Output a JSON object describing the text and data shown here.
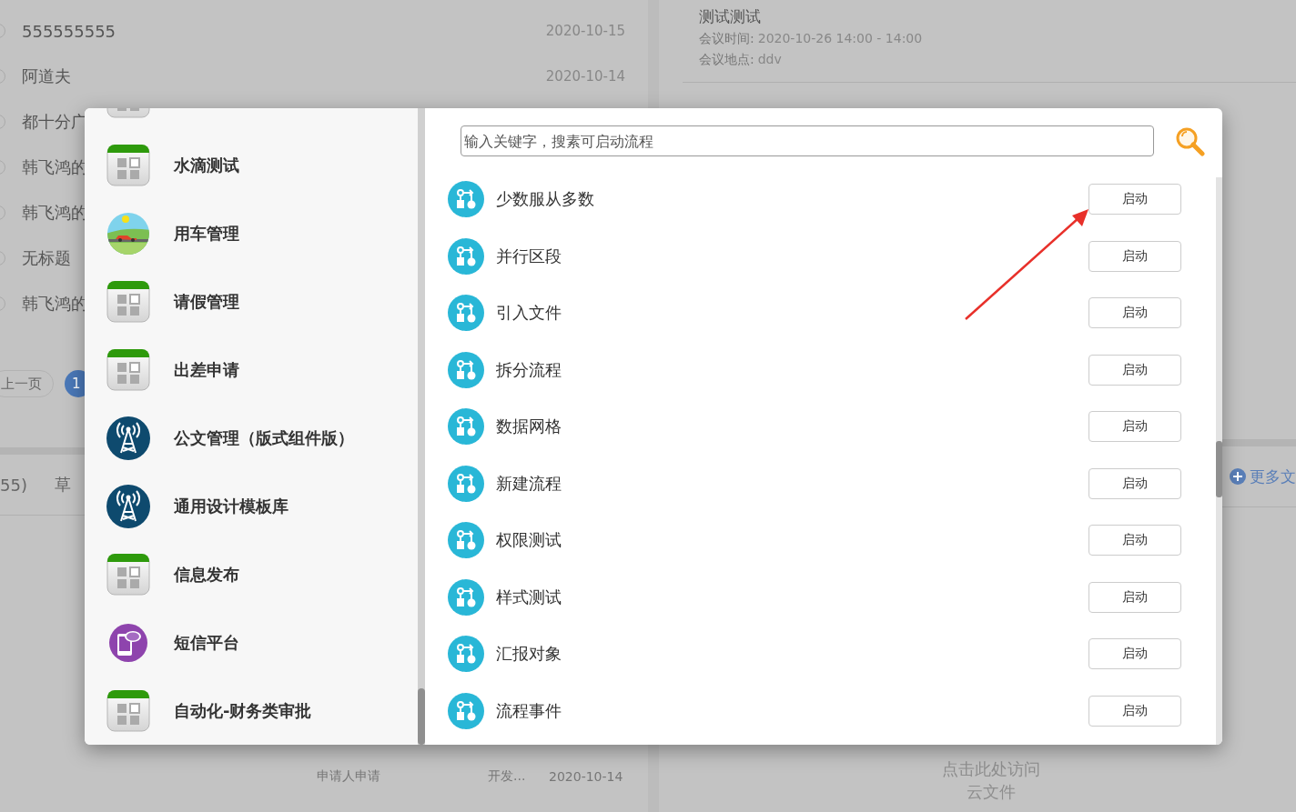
{
  "background": {
    "documents": [
      {
        "title": "555555555",
        "date": "2020-10-15"
      },
      {
        "title": "阿道夫",
        "date": "2020-10-14"
      },
      {
        "title": "都十分广"
      },
      {
        "title": "韩飞鸿的"
      },
      {
        "title": "韩飞鸿的"
      },
      {
        "title": "无标题"
      },
      {
        "title": "韩飞鸿的"
      }
    ],
    "pagination": {
      "prev": "上一页",
      "pages": [
        {
          "label": "1",
          "selected": true
        }
      ]
    },
    "tabs": [
      {
        "label": "55)"
      },
      {
        "label": "草"
      }
    ],
    "bottom_row": {
      "column_1": "申请人申请",
      "column_2": "开发...",
      "column_3": "2020-10-14"
    },
    "meeting": {
      "title": "测试测试",
      "time_label": "会议时间:",
      "time": "2020-10-26 14:00 - 14:00",
      "place_label": "会议地点:",
      "place": "ddv"
    },
    "more_files": "更多文",
    "cloud_link": [
      "点击此处访问",
      "云文件"
    ]
  },
  "dialog": {
    "apps": [
      {
        "kind": "grid"
      },
      {
        "name": "水滴测试",
        "kind": "grid"
      },
      {
        "name": "用车管理",
        "kind": "car"
      },
      {
        "name": "请假管理",
        "kind": "grid"
      },
      {
        "name": "出差申请",
        "kind": "grid"
      },
      {
        "name": "公文管理（版式组件版）",
        "kind": "antenna"
      },
      {
        "name": "通用设计模板库",
        "kind": "antenna"
      },
      {
        "name": "信息发布",
        "kind": "grid"
      },
      {
        "name": "短信平台",
        "kind": "sms"
      },
      {
        "name": "自动化-财务类审批",
        "kind": "grid"
      }
    ],
    "search": {
      "placeholder": "输入关键字，搜素可启动流程"
    },
    "processes": [
      {
        "name": "少数服从多数",
        "button": "启动"
      },
      {
        "name": "并行区段",
        "button": "启动"
      },
      {
        "name": "引入文件",
        "button": "启动"
      },
      {
        "name": "拆分流程",
        "button": "启动"
      },
      {
        "name": "数据网格",
        "button": "启动"
      },
      {
        "name": "新建流程",
        "button": "启动"
      },
      {
        "name": "权限测试",
        "button": "启动"
      },
      {
        "name": "样式测试",
        "button": "启动"
      },
      {
        "name": "汇报对象",
        "button": "启动"
      },
      {
        "name": "流程事件",
        "button": "启动"
      }
    ]
  }
}
